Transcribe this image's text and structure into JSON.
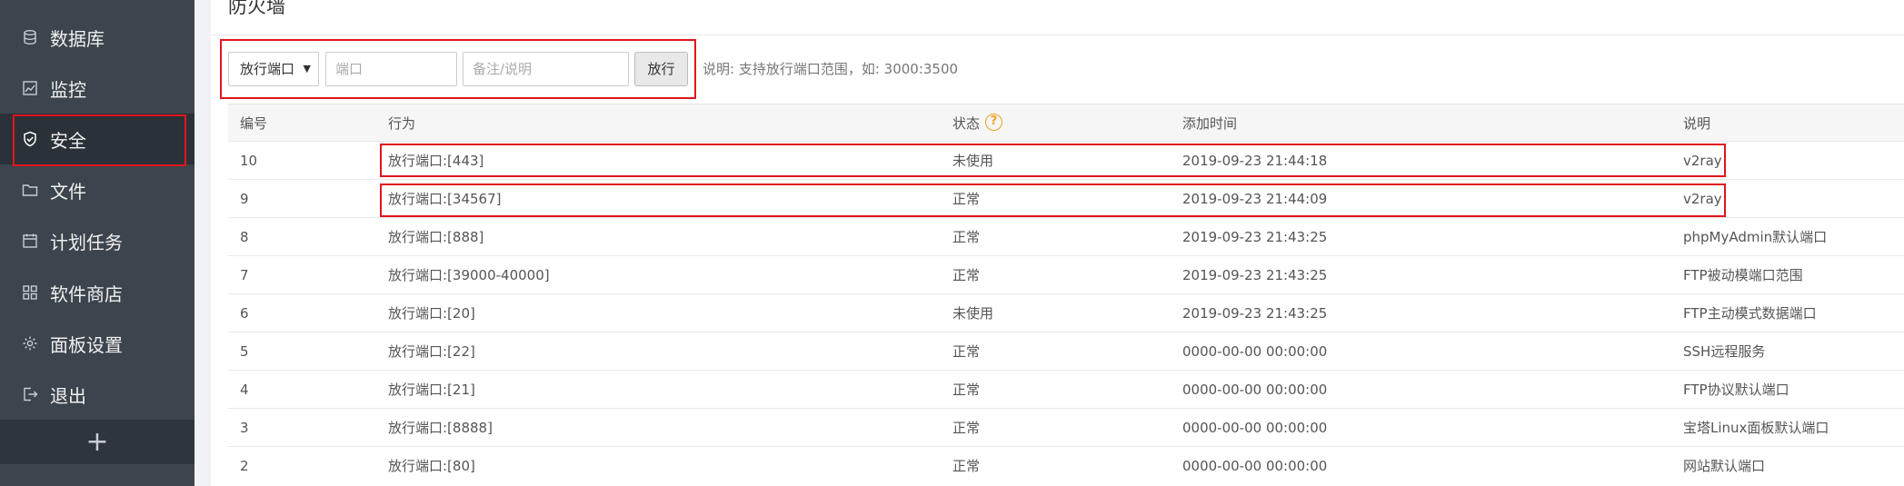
{
  "sidebar": {
    "items": [
      {
        "label": "数据库",
        "icon": "database-icon"
      },
      {
        "label": "监控",
        "icon": "monitor-icon"
      },
      {
        "label": "安全",
        "icon": "shield-icon"
      },
      {
        "label": "文件",
        "icon": "folder-icon"
      },
      {
        "label": "计划任务",
        "icon": "calendar-icon"
      },
      {
        "label": "软件商店",
        "icon": "grid-icon"
      },
      {
        "label": "面板设置",
        "icon": "gear-icon"
      },
      {
        "label": "退出",
        "icon": "logout-icon"
      }
    ],
    "active_index": 2,
    "add_label": "+"
  },
  "page": {
    "title": "防火墙"
  },
  "toolbar": {
    "select_value": "放行端口",
    "port_placeholder": "端口",
    "note_placeholder": "备注/说明",
    "submit_label": "放行",
    "hint": "说明: 支持放行端口范围，如: 3000:3500"
  },
  "table": {
    "headers": {
      "id": "编号",
      "action": "行为",
      "status": "状态",
      "time": "添加时间",
      "desc": "说明"
    },
    "rows": [
      {
        "id": "10",
        "action": "放行端口:[443]",
        "status": "未使用",
        "time": "2019-09-23 21:44:18",
        "desc": "v2ray"
      },
      {
        "id": "9",
        "action": "放行端口:[34567]",
        "status": "正常",
        "time": "2019-09-23 21:44:09",
        "desc": "v2ray"
      },
      {
        "id": "8",
        "action": "放行端口:[888]",
        "status": "正常",
        "time": "2019-09-23 21:43:25",
        "desc": "phpMyAdmin默认端口"
      },
      {
        "id": "7",
        "action": "放行端口:[39000-40000]",
        "status": "正常",
        "time": "2019-09-23 21:43:25",
        "desc": "FTP被动模端口范围"
      },
      {
        "id": "6",
        "action": "放行端口:[20]",
        "status": "未使用",
        "time": "2019-09-23 21:43:25",
        "desc": "FTP主动模式数据端口"
      },
      {
        "id": "5",
        "action": "放行端口:[22]",
        "status": "正常",
        "time": "0000-00-00 00:00:00",
        "desc": "SSH远程服务"
      },
      {
        "id": "4",
        "action": "放行端口:[21]",
        "status": "正常",
        "time": "0000-00-00 00:00:00",
        "desc": "FTP协议默认端口"
      },
      {
        "id": "3",
        "action": "放行端口:[8888]",
        "status": "正常",
        "time": "0000-00-00 00:00:00",
        "desc": "宝塔Linux面板默认端口"
      },
      {
        "id": "2",
        "action": "放行端口:[80]",
        "status": "正常",
        "time": "0000-00-00 00:00:00",
        "desc": "网站默认端口"
      }
    ]
  },
  "colors": {
    "sidebar_bg": "#3c444d",
    "highlight": "#e0151b",
    "help_icon": "#f0a020"
  }
}
